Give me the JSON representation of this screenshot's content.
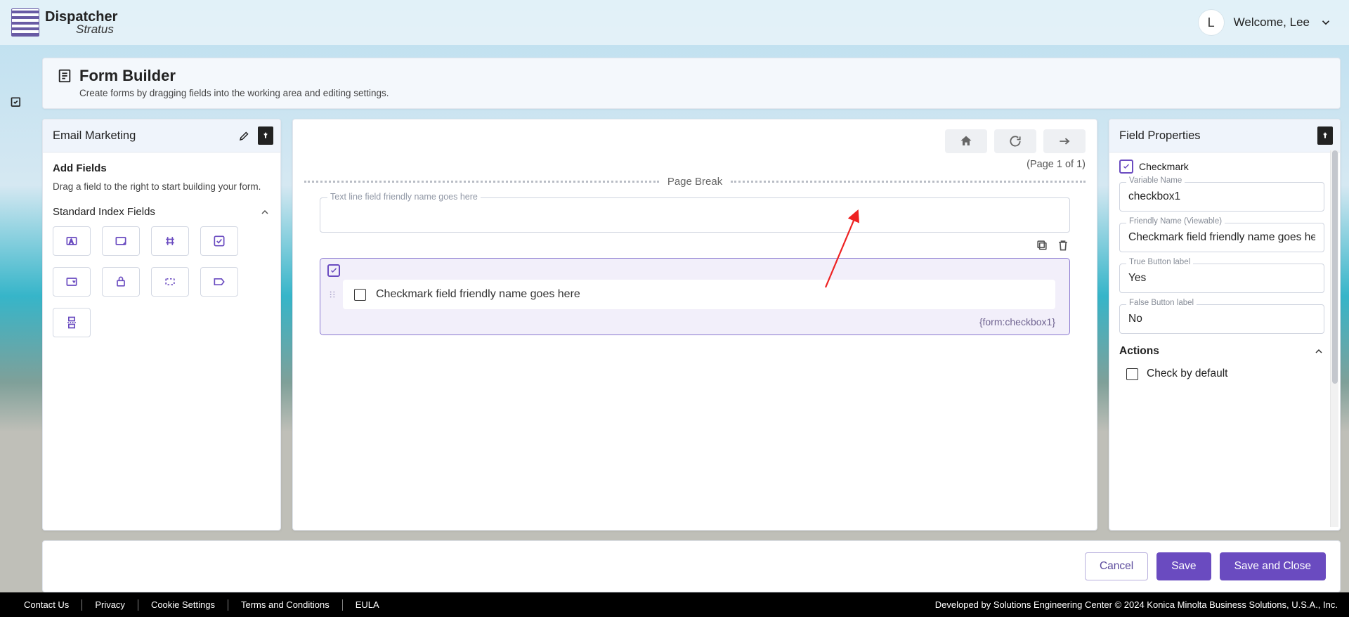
{
  "brand": {
    "line1": "Dispatcher",
    "line2": "Stratus"
  },
  "user": {
    "initial": "L",
    "welcome": "Welcome, Lee"
  },
  "page": {
    "title": "Form Builder",
    "subtitle": "Create forms by dragging fields into the working area and editing settings."
  },
  "left_panel": {
    "form_name": "Email Marketing",
    "add_fields_heading": "Add Fields",
    "add_fields_help": "Drag a field to the right to start building your form.",
    "group_label": "Standard Index Fields",
    "tiles": [
      "text-field",
      "textarea-field",
      "number-field",
      "checkbox-field",
      "dropdown-field",
      "secure-field",
      "selection-field",
      "tag-field",
      "pagebreak-field"
    ]
  },
  "canvas": {
    "page_info": "(Page 1 of 1)",
    "page_break_label": "Page Break",
    "text_line_placeholder": "Text line field friendly name goes here",
    "checkmark_label": "Checkmark field friendly name goes here",
    "checkmark_var": "{form:checkbox1}"
  },
  "right_panel": {
    "title": "Field Properties",
    "type_label": "Checkmark",
    "variable_name_label": "Variable Name",
    "variable_name_value": "checkbox1",
    "friendly_name_label": "Friendly Name (Viewable)",
    "friendly_name_value": "Checkmark field friendly name goes here",
    "true_label_label": "True Button label",
    "true_label_value": "Yes",
    "false_label_label": "False Button label",
    "false_label_value": "No",
    "actions_heading": "Actions",
    "action_check_default": "Check by default"
  },
  "buttons": {
    "cancel": "Cancel",
    "save": "Save",
    "save_close": "Save and Close"
  },
  "footer": {
    "links": [
      "Contact Us",
      "Privacy",
      "Cookie Settings",
      "Terms and Conditions",
      "EULA"
    ],
    "copyright": "Developed by Solutions Engineering Center © 2024 Konica Minolta Business Solutions, U.S.A., Inc."
  }
}
